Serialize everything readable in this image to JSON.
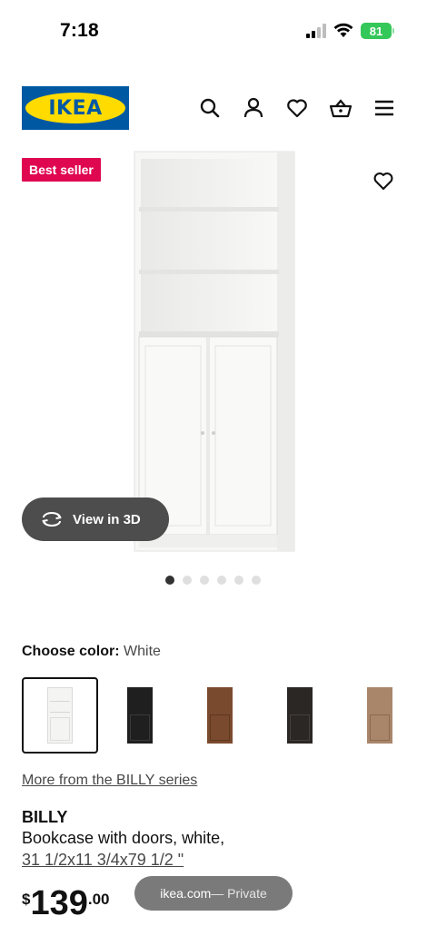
{
  "status_bar": {
    "time": "7:18",
    "battery": "81",
    "icons": [
      "signal-icon",
      "wifi-icon",
      "battery-icon"
    ]
  },
  "header": {
    "logo_text": "IKEA",
    "icons": [
      "search-icon",
      "account-icon",
      "heart-icon",
      "basket-icon",
      "menu-icon"
    ]
  },
  "product_media": {
    "badge": "Best seller",
    "view_3d_label": "View in 3D",
    "dots_total": 6,
    "dots_active": 1
  },
  "color_chooser": {
    "label": "Choose color:",
    "selected_value": "White",
    "options": [
      {
        "name": "white",
        "color": "#f4f4f2",
        "selected": true
      },
      {
        "name": "black",
        "color": "#1f1f1f",
        "selected": false
      },
      {
        "name": "walnut-brown",
        "color": "#7a4a2e",
        "selected": false
      },
      {
        "name": "black-brown",
        "color": "#2b2724",
        "selected": false
      },
      {
        "name": "oak-effect",
        "color": "#a9856a",
        "selected": false
      }
    ]
  },
  "product": {
    "series_link": "More from the BILLY series",
    "name": "BILLY",
    "description": "Bookcase with doors, white,",
    "dimensions": "31 1/2x11 3/4x79 1/2 \"",
    "price_currency": "$",
    "price_integer": "139",
    "price_decimal": ".00"
  },
  "browser": {
    "url": "ikea.com",
    "mode": " — Private"
  },
  "colors": {
    "ikea_blue": "#0058a3",
    "ikea_yellow": "#ffdb00",
    "badge_red": "#e00751",
    "battery_green": "#34c759"
  }
}
